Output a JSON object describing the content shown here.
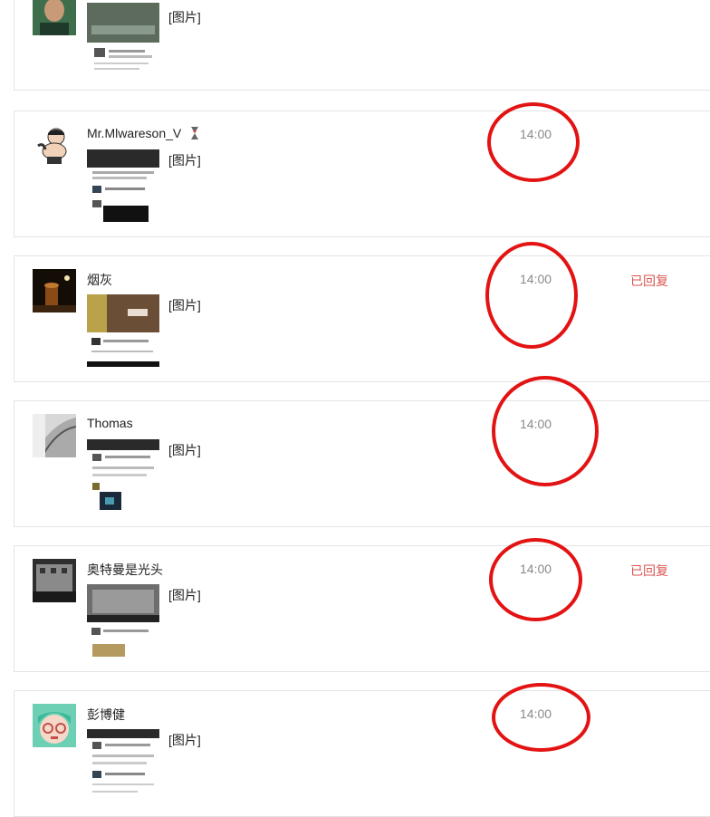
{
  "placeholder_text": "[图片]",
  "messages": [
    {
      "name": "",
      "content": "[图片]",
      "time": "",
      "status": ""
    },
    {
      "name": "Mr.Mlwareson_V",
      "content": "[图片]",
      "time": "14:00",
      "status": ""
    },
    {
      "name": "烟灰",
      "content": "[图片]",
      "time": "14:00",
      "status": "已回复"
    },
    {
      "name": "Thomas",
      "content": "[图片]",
      "time": "14:00",
      "status": ""
    },
    {
      "name": "奥特曼是光头",
      "content": "[图片]",
      "time": "14:00",
      "status": "已回复"
    },
    {
      "name": "彭博健",
      "content": "[图片]",
      "time": "14:00",
      "status": ""
    }
  ],
  "colors": {
    "annotation_circle": "#e31313",
    "status_replied": "#d9534f",
    "time": "#8a8a8a"
  },
  "icons": [
    "hourglass-icon"
  ]
}
